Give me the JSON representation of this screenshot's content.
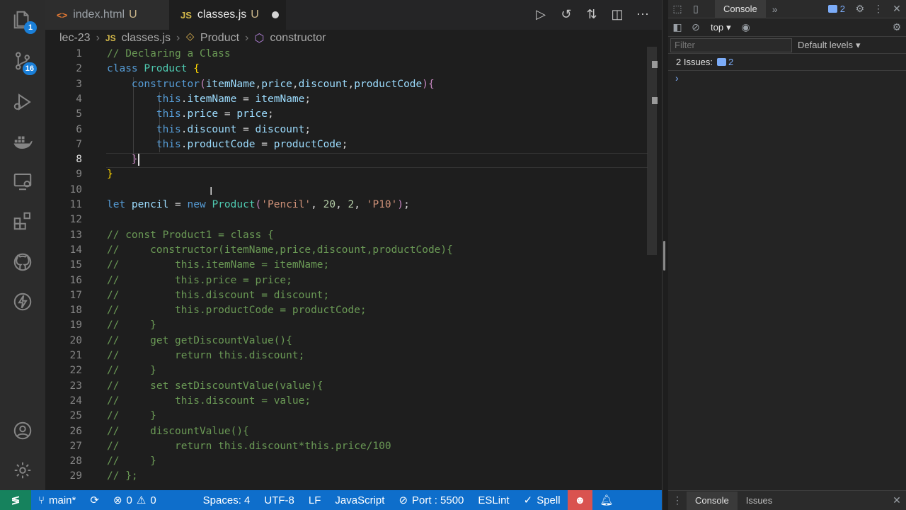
{
  "activity": {
    "explorer_badge": "1",
    "scm_badge": "16"
  },
  "tabs": [
    {
      "icon": "<>",
      "name": "index.html",
      "status": "U"
    },
    {
      "icon": "JS",
      "name": "classes.js",
      "status": "U"
    }
  ],
  "breadcrumb": [
    "lec-23",
    "classes.js",
    "Product",
    "constructor"
  ],
  "breadcrumb_js": "JS",
  "cursor_line": 8,
  "code": [
    [
      [
        "c",
        "// Declaring a Class"
      ]
    ],
    [
      [
        "k",
        "class "
      ],
      [
        "t",
        "Product "
      ],
      [
        "b",
        "{"
      ]
    ],
    [
      [
        "p",
        "    "
      ],
      [
        "k",
        "constructor"
      ],
      [
        "kk",
        "("
      ],
      [
        "v",
        "itemName"
      ],
      [
        "p",
        ","
      ],
      [
        "v",
        "price"
      ],
      [
        "p",
        ","
      ],
      [
        "v",
        "discount"
      ],
      [
        "p",
        ","
      ],
      [
        "v",
        "productCode"
      ],
      [
        "kk",
        "){"
      ]
    ],
    [
      [
        "p",
        "        "
      ],
      [
        "k",
        "this"
      ],
      [
        "p",
        "."
      ],
      [
        "v",
        "itemName"
      ],
      [
        "p",
        " = "
      ],
      [
        "v",
        "itemName"
      ],
      [
        "p",
        ";"
      ]
    ],
    [
      [
        "p",
        "        "
      ],
      [
        "k",
        "this"
      ],
      [
        "p",
        "."
      ],
      [
        "v",
        "price"
      ],
      [
        "p",
        " = "
      ],
      [
        "v",
        "price"
      ],
      [
        "p",
        ";"
      ]
    ],
    [
      [
        "p",
        "        "
      ],
      [
        "k",
        "this"
      ],
      [
        "p",
        "."
      ],
      [
        "v",
        "discount"
      ],
      [
        "p",
        " = "
      ],
      [
        "v",
        "discount"
      ],
      [
        "p",
        ";"
      ]
    ],
    [
      [
        "p",
        "        "
      ],
      [
        "k",
        "this"
      ],
      [
        "p",
        "."
      ],
      [
        "v",
        "productCode"
      ],
      [
        "p",
        " = "
      ],
      [
        "v",
        "productCode"
      ],
      [
        "p",
        ";"
      ]
    ],
    [
      [
        "p",
        "    "
      ],
      [
        "kk",
        "}"
      ]
    ],
    [
      [
        "b",
        "}"
      ]
    ],
    [],
    [
      [
        "k",
        "let "
      ],
      [
        "v",
        "pencil"
      ],
      [
        "p",
        " = "
      ],
      [
        "k",
        "new "
      ],
      [
        "t",
        "Product"
      ],
      [
        "kk",
        "("
      ],
      [
        "s",
        "'Pencil'"
      ],
      [
        "p",
        ", "
      ],
      [
        "n",
        "20"
      ],
      [
        "p",
        ", "
      ],
      [
        "n",
        "2"
      ],
      [
        "p",
        ", "
      ],
      [
        "s",
        "'P10'"
      ],
      [
        "kk",
        ")"
      ],
      [
        "p",
        ";"
      ]
    ],
    [],
    [
      [
        "c",
        "// const Product1 = class {"
      ]
    ],
    [
      [
        "c",
        "//     constructor(itemName,price,discount,productCode){"
      ]
    ],
    [
      [
        "c",
        "//         this.itemName = itemName;"
      ]
    ],
    [
      [
        "c",
        "//         this.price = price;"
      ]
    ],
    [
      [
        "c",
        "//         this.discount = discount;"
      ]
    ],
    [
      [
        "c",
        "//         this.productCode = productCode;"
      ]
    ],
    [
      [
        "c",
        "//     }"
      ]
    ],
    [
      [
        "c",
        "//     get getDiscountValue(){"
      ]
    ],
    [
      [
        "c",
        "//         return this.discount;"
      ]
    ],
    [
      [
        "c",
        "//     }"
      ]
    ],
    [
      [
        "c",
        "//     set setDiscountValue(value){"
      ]
    ],
    [
      [
        "c",
        "//         this.discount = value;"
      ]
    ],
    [
      [
        "c",
        "//     }"
      ]
    ],
    [
      [
        "c",
        "//     discountValue(){"
      ]
    ],
    [
      [
        "c",
        "//         return this.discount*this.price/100"
      ]
    ],
    [
      [
        "c",
        "//     }"
      ]
    ],
    [
      [
        "c",
        "// };"
      ]
    ]
  ],
  "status": {
    "branch": "main*",
    "errors": "0",
    "warnings": "0",
    "spaces": "Spaces: 4",
    "encoding": "UTF-8",
    "eol": "LF",
    "language": "JavaScript",
    "port": "Port : 5500",
    "eslint": "ESLint",
    "spell": "Spell"
  },
  "devtools": {
    "tab_console": "Console",
    "issue_count_badge": "2",
    "context": "top",
    "filter_placeholder": "Filter",
    "levels": "Default levels",
    "issues_text": "2 Issues:",
    "issues_count": "2",
    "prompt": "›",
    "drawer_console": "Console",
    "drawer_issues": "Issues"
  },
  "colors": {
    "status_bar": "#0e6ecb",
    "remote": "#16825d",
    "accent_badge": "#1a7fd8"
  }
}
